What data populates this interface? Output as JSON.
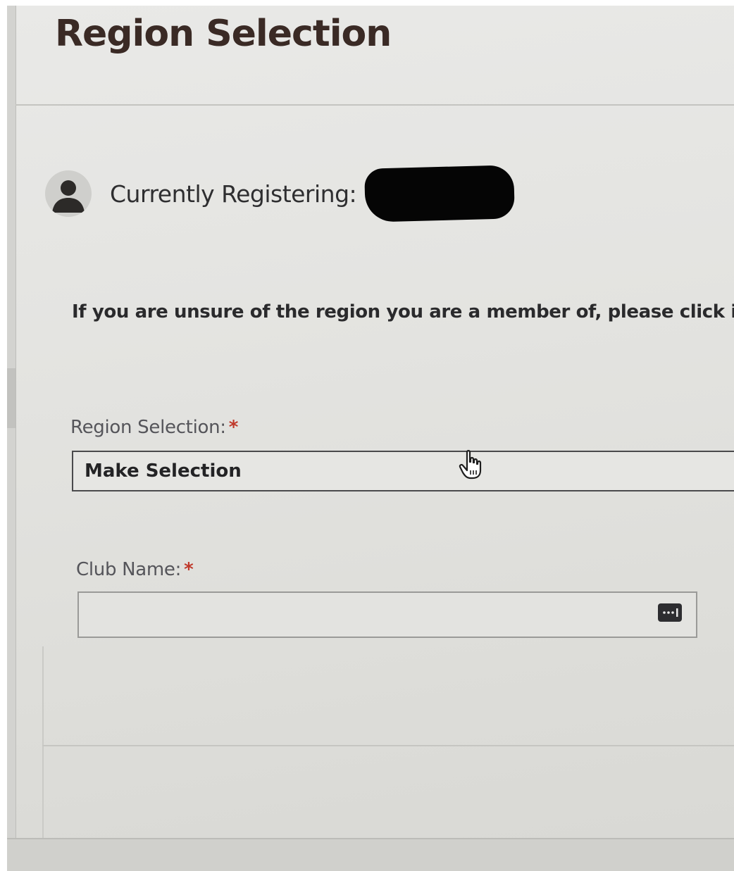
{
  "header": {
    "title": "Region Selection"
  },
  "registering": {
    "label": "Currently Registering:",
    "avatar_icon": "user-avatar-icon"
  },
  "info": {
    "text": "If you are unsure of the region you are a member of, please click into y"
  },
  "region_field": {
    "label": "Region Selection:",
    "required_marker": "*",
    "selected_value": "Make Selection"
  },
  "club_field": {
    "label": "Club Name:",
    "required_marker": "*",
    "value": "",
    "autofill_icon": "autofill-dots-icon"
  },
  "colors": {
    "required": "#c0392b",
    "title": "#3a2a25"
  }
}
